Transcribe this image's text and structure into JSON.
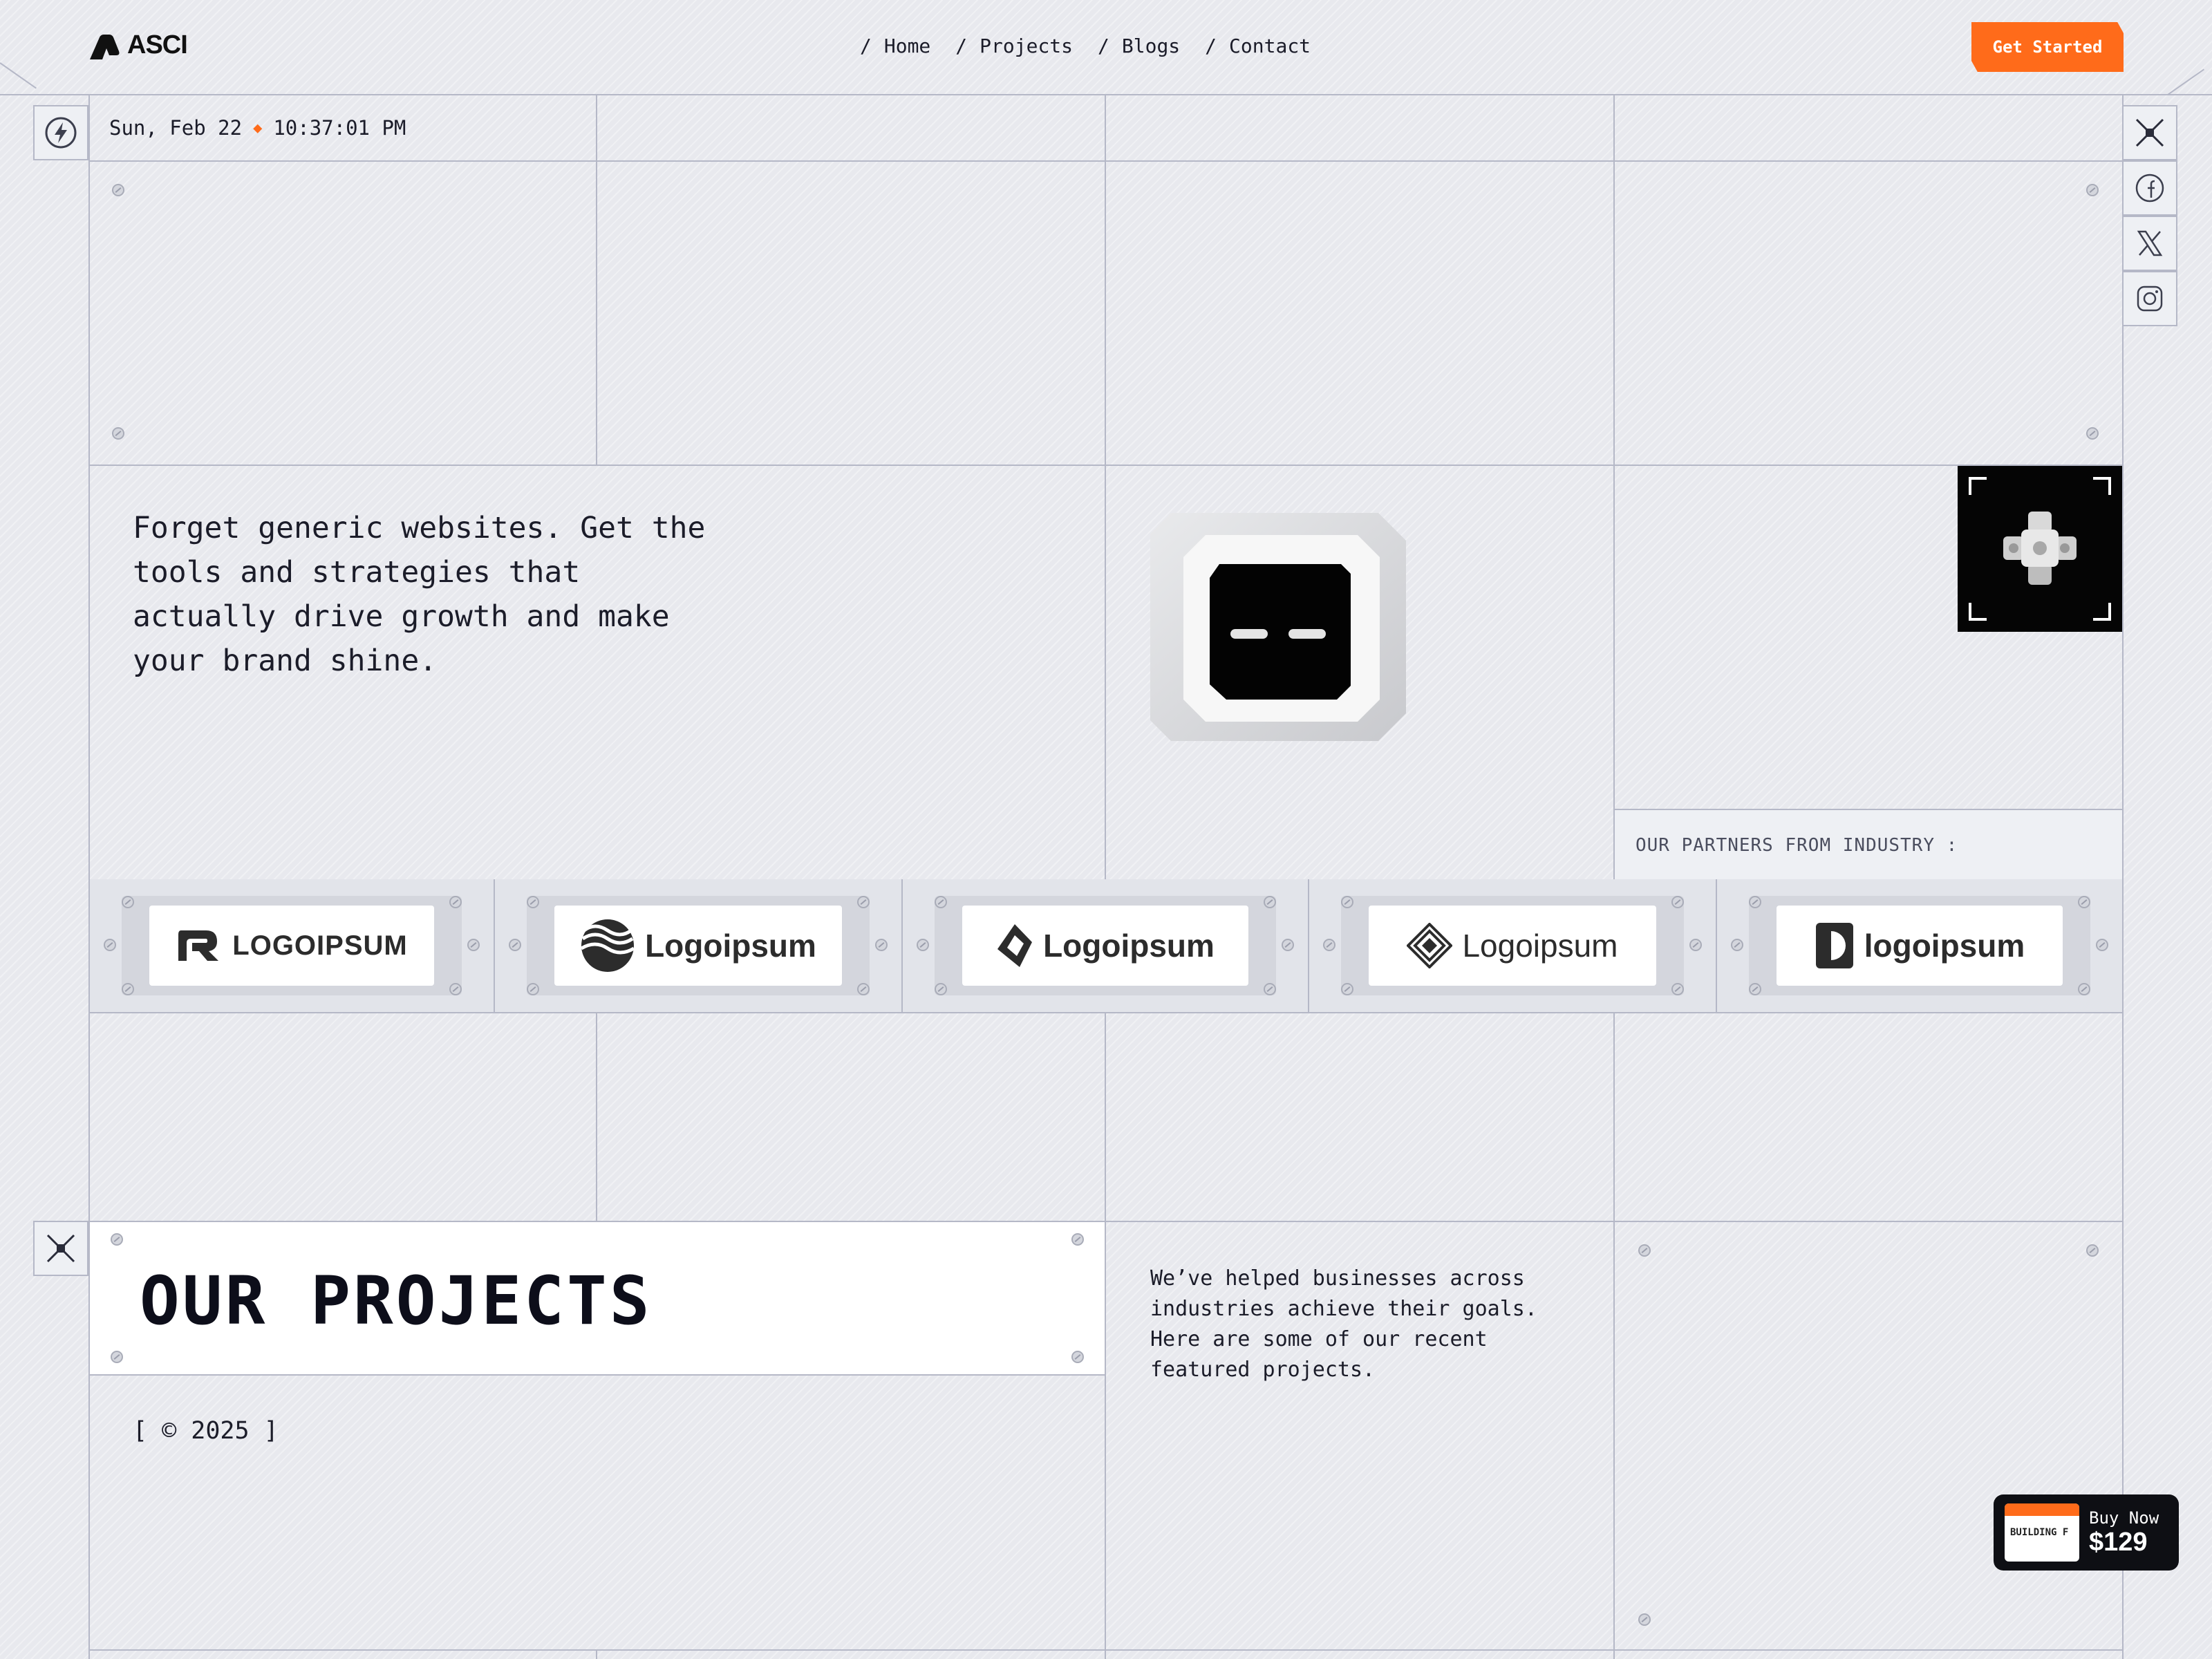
{
  "header": {
    "brand": "ASCI",
    "nav": [
      {
        "slash": "/",
        "label": "Home"
      },
      {
        "slash": "/",
        "label": "Projects"
      },
      {
        "slash": "/",
        "label": "Blogs"
      },
      {
        "slash": "/",
        "label": "Contact"
      }
    ],
    "cta_label": "Get Started"
  },
  "status": {
    "date": "Sun, Feb 22",
    "time": "10:37:01 PM",
    "separator": "◆"
  },
  "social": [
    "close-x-icon",
    "facebook-icon",
    "x-twitter-icon",
    "instagram-icon"
  ],
  "hero": {
    "headline": "Forget generic websites. Get the tools and strategies that actually drive growth and make your brand shine."
  },
  "partners": {
    "label": "OUR PARTNERS FROM INDUSTRY :",
    "logos": [
      "LOGOIPSUM",
      "Logoipsum",
      "Logoipsum",
      "Logoipsum",
      "logoipsum"
    ]
  },
  "projects": {
    "title": "OUR PROJECTS",
    "copyright": "[ © 2025 ]",
    "description": "We’ve helped businesses across industries achieve their goals. Here are some of our recent featured projects."
  },
  "buy_widget": {
    "thumb_text": "BUILDING F",
    "label": "Buy Now",
    "price": "$129"
  },
  "colors": {
    "accent": "#ff6b1a",
    "background": "#e8e9ee",
    "grid_line": "#b5b8c7",
    "text": "#1b1c29"
  }
}
